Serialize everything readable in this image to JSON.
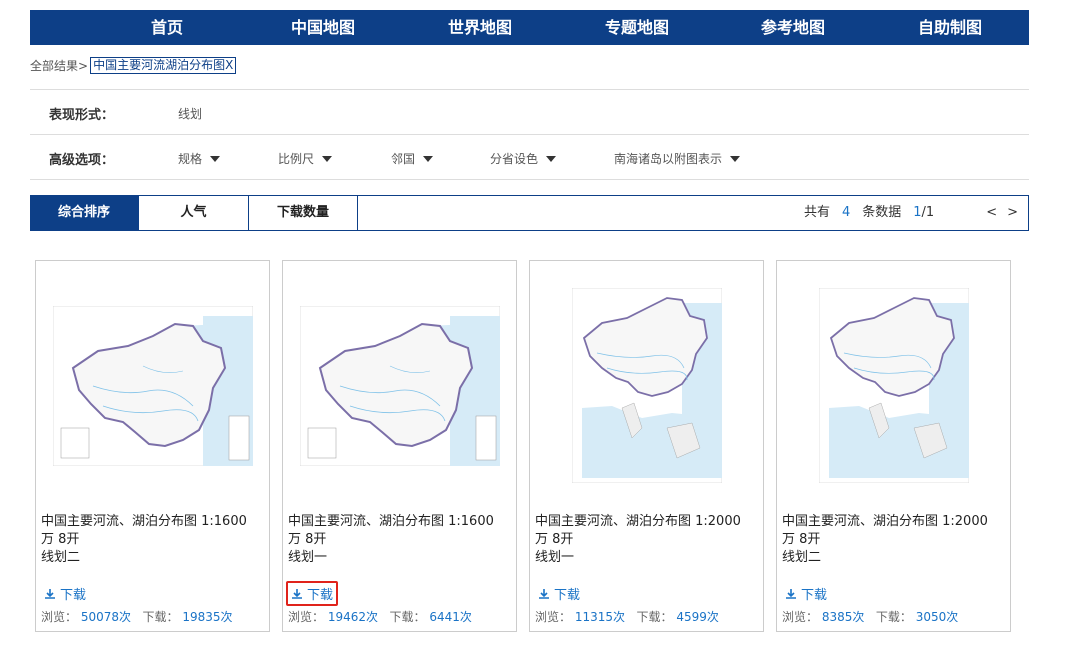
{
  "nav": {
    "items": [
      "首页",
      "中国地图",
      "世界地图",
      "专题地图",
      "参考地图",
      "自助制图"
    ]
  },
  "breadcrumb": {
    "root": "全部结果>",
    "tag": "中国主要河流湖泊分布图X"
  },
  "filters": {
    "form_label": "表现形式：",
    "form_value": "线划",
    "advanced_label": "高级选项：",
    "advanced_options": [
      "规格",
      "比例尺",
      "邻国",
      "分省设色",
      "南海诸岛以附图表示"
    ]
  },
  "sort": {
    "tabs": [
      "综合排序",
      "人气",
      "下载数量"
    ],
    "total_prefix": "共有",
    "total": "4",
    "total_suffix": "条数据",
    "page": "1",
    "page_total": "/1",
    "prev": "<",
    "next": ">"
  },
  "cards": [
    {
      "title_line1": "中国主要河流、湖泊分布图 1:1600",
      "title_line2": "万 8开",
      "title_line3": "线划二",
      "download": "下载",
      "views_label": "浏览：",
      "views": "50078次",
      "downloads_label": "下载：",
      "downloads": "19835次"
    },
    {
      "title_line1": "中国主要河流、湖泊分布图 1:1600",
      "title_line2": "万 8开",
      "title_line3": "线划一",
      "download": "下载",
      "views_label": "浏览：",
      "views": "19462次",
      "downloads_label": "下载：",
      "downloads": "6441次"
    },
    {
      "title_line1": "中国主要河流、湖泊分布图 1:2000",
      "title_line2": "万 8开",
      "title_line3": "线划一",
      "download": "下载",
      "views_label": "浏览：",
      "views": "11315次",
      "downloads_label": "下载：",
      "downloads": "4599次"
    },
    {
      "title_line1": "中国主要河流、湖泊分布图 1:2000",
      "title_line2": "万 8开",
      "title_line3": "线划二",
      "download": "下载",
      "views_label": "浏览：",
      "views": "8385次",
      "downloads_label": "下载：",
      "downloads": "3050次"
    }
  ],
  "colors": {
    "brand": "#0d3f87",
    "link": "#1a73c6",
    "highlight": "#e0231b"
  }
}
